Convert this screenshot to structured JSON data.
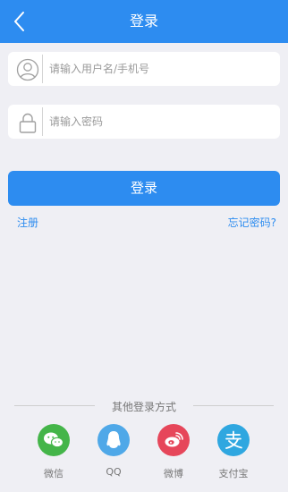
{
  "header": {
    "title": "登录"
  },
  "username_field": {
    "placeholder": "请输入用户名/手机号",
    "value": ""
  },
  "password_field": {
    "placeholder": "请输入密码",
    "value": ""
  },
  "login_button": {
    "label": "登录"
  },
  "links": {
    "register": "注册",
    "forgot_password": "忘记密码?"
  },
  "other_login": {
    "title": "其他登录方式",
    "methods": [
      {
        "label": "微信",
        "icon": "wechat-icon",
        "color": "#44b549"
      },
      {
        "label": "QQ",
        "icon": "qq-icon",
        "color": "#4fa8e8"
      },
      {
        "label": "微博",
        "icon": "weibo-icon",
        "color": "#e6465a"
      },
      {
        "label": "支付宝",
        "icon": "alipay-icon",
        "color": "#2fa7e0"
      }
    ]
  },
  "colors": {
    "primary": "#2d8cf0",
    "background": "#efeff4"
  }
}
